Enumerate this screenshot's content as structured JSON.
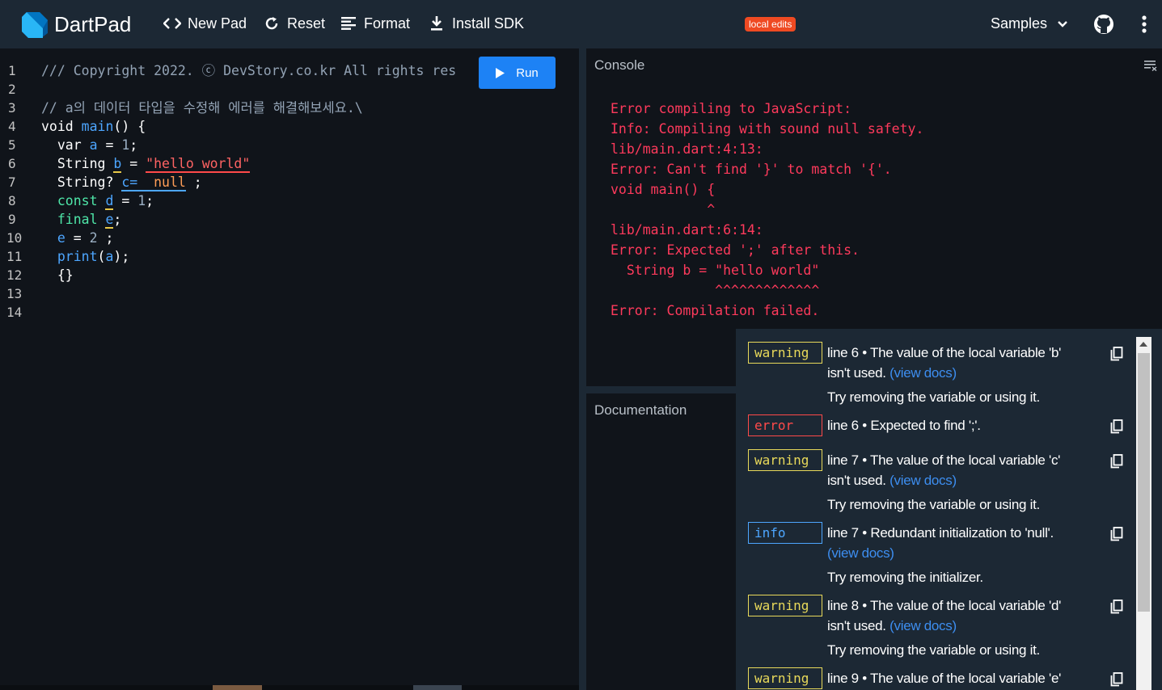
{
  "header": {
    "brand": "DartPad",
    "new_pad": "New Pad",
    "reset": "Reset",
    "format": "Format",
    "install_sdk": "Install SDK",
    "badge": "local edits",
    "samples": "Samples"
  },
  "editor": {
    "line_numbers": [
      "1",
      "2",
      "3",
      "4",
      "5",
      "6",
      "7",
      "8",
      "9",
      "10",
      "11",
      "12",
      "13",
      "14"
    ],
    "run_label": "Run",
    "lines": {
      "l1": "/// Copyright 2022. ⓒ DevStory.co.kr All rights res",
      "l3": "// a의 데이터 타입을 수정해 에러를 해결해보세요.\\",
      "l4a": "void ",
      "l4b": "main",
      "l4c": "() {",
      "l5a": "  var ",
      "l5b": "a",
      "l5c": " = ",
      "l5d": "1",
      "l5e": ";",
      "l6a": "  String ",
      "l6b": "b",
      "l6c": " = ",
      "l6d": "\"hello world\"",
      "l7a": "  String? ",
      "l7b": "c=",
      "l7c": "  ",
      "l7d": "null",
      "l7e": " ;",
      "l8a": "  ",
      "l8b": "const",
      "l8c": " ",
      "l8d": "d",
      "l8e": " = ",
      "l8f": "1",
      "l8g": ";",
      "l9a": "  ",
      "l9b": "final",
      "l9c": " ",
      "l9d": "e",
      "l9e": ";",
      "l10a": "  ",
      "l10b": "e",
      "l10c": " = ",
      "l10d": "2",
      "l10e": " ;",
      "l11a": "  ",
      "l11b": "print",
      "l11c": "(",
      "l11d": "a",
      "l11e": ");",
      "l12": "  {}"
    }
  },
  "console": {
    "title": "Console",
    "output": [
      "Error compiling to JavaScript:",
      "Info: Compiling with sound null safety.",
      "lib/main.dart:4:13:",
      "Error: Can't find '}' to match '{'.",
      "void main() {",
      "            ^",
      "lib/main.dart:6:14:",
      "Error: Expected ';' after this.",
      "  String b = \"hello world\"",
      "             ^^^^^^^^^^^^^",
      "Error: Compilation failed."
    ]
  },
  "docs": {
    "title": "Documentation"
  },
  "issues": [
    {
      "kind": "warning",
      "line1": "line 6 • The value of the local variable 'b'",
      "line2": "isn't used.",
      "link": "(view docs)",
      "fix": "Try removing the variable or using it."
    },
    {
      "kind": "error",
      "line1": "line 6 • Expected to find ';'."
    },
    {
      "kind": "warning",
      "line1": "line 7 • The value of the local variable 'c'",
      "line2": "isn't used.",
      "link": "(view docs)",
      "fix": "Try removing the variable or using it."
    },
    {
      "kind": "info",
      "line1": "line 7 • Redundant initialization to 'null'.",
      "link": "(view docs)",
      "fix": "Try removing the initializer."
    },
    {
      "kind": "warning",
      "line1": "line 8 • The value of the local variable 'd'",
      "line2": "isn't used.",
      "link": "(view docs)",
      "fix": "Try removing the variable or using it."
    },
    {
      "kind": "warning",
      "line1": "line 9 • The value of the local variable 'e'"
    }
  ],
  "colors": {
    "accent": "#1d82f5",
    "badge": "#ef4a22",
    "error": "#ff3a5c",
    "warning": "#e8d95a",
    "info": "#4da6ff"
  }
}
